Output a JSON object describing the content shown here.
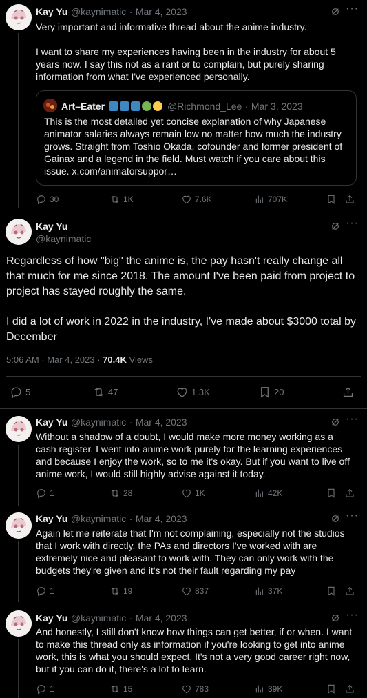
{
  "tweet1": {
    "name": "Kay Yu",
    "handle": "@kaynimatic",
    "date": "Mar 4, 2023",
    "sep": "·",
    "text": "Very important and informative thread about the anime industry.\n\nI want to share my experiences having been in the industry for about 5 years now. I say this not as a rant or to complain, but purely sharing information from what I've experienced personally.",
    "quote": {
      "name": "Art–Eater",
      "emoji": "➡️⬇️↘️🐊👊",
      "handle": "@Richmond_Lee",
      "date": "Mar 3, 2023",
      "text": "This is the most detailed yet concise explanation of why Japanese animator salaries always remain low no matter how much the industry grows. Straight from Toshio Okada, cofounder and former president of Gainax and a legend in the field. Must watch if you care about this issue. x.com/animatorsuppor…"
    },
    "replies": "30",
    "reposts": "1K",
    "likes": "7.6K",
    "views": "707K"
  },
  "main_tweet": {
    "name": "Kay Yu",
    "handle": "@kaynimatic",
    "text": "Regardless of how \"big\" the anime is, the pay hasn't really change all that much for me since 2018. The amount I've been paid from project to project has stayed roughly the same.\n\nI did a lot of work in 2022 in the industry, I've made about $3000 total by December",
    "timestamp": "5:06 AM · Mar 4, 2023 · ",
    "views_count": "70.4K",
    "views_label": " Views",
    "replies": "5",
    "reposts": "47",
    "likes": "1.3K",
    "bookmarks": "20"
  },
  "replies": [
    {
      "name": "Kay Yu",
      "handle": "@kaynimatic",
      "date": "Mar 4, 2023",
      "text": "Without a shadow of a doubt, I would make more money working as a cash register. I went into anime work purely for the learning experiences and because I enjoy the work, so to me it's okay. But if you want to live off anime work, I would still highly advise against it today.",
      "replies": "1",
      "reposts": "28",
      "likes": "1K",
      "views": "42K"
    },
    {
      "name": "Kay Yu",
      "handle": "@kaynimatic",
      "date": "Mar 4, 2023",
      "text": "Again let me reiterate that I'm not complaining, especially not the studios that I work with directly. the PAs and directors I've worked with are extremely nice and pleasant to work with. They can only work with the budgets they're given and it's not their fault regarding my pay",
      "replies": "1",
      "reposts": "19",
      "likes": "837",
      "views": "37K"
    },
    {
      "name": "Kay Yu",
      "handle": "@kaynimatic",
      "date": "Mar 4, 2023",
      "text": "And honestly, I still don't know how things can get better, if or when. I want to make this thread only as information if you're looking to get into anime work, this is what you should expect. It's not a very good career right now, but if you can do it, there's a lot to learn.",
      "replies": "1",
      "reposts": "15",
      "likes": "783",
      "views": "39K"
    }
  ],
  "colors": {
    "background": "#000000",
    "text": "#e7e9ea",
    "muted": "#71767b",
    "border": "#2f3336"
  },
  "icons": [
    "grok-icon",
    "more-icon",
    "reply-icon",
    "repost-icon",
    "like-icon",
    "views-icon",
    "bookmark-icon",
    "share-icon"
  ]
}
